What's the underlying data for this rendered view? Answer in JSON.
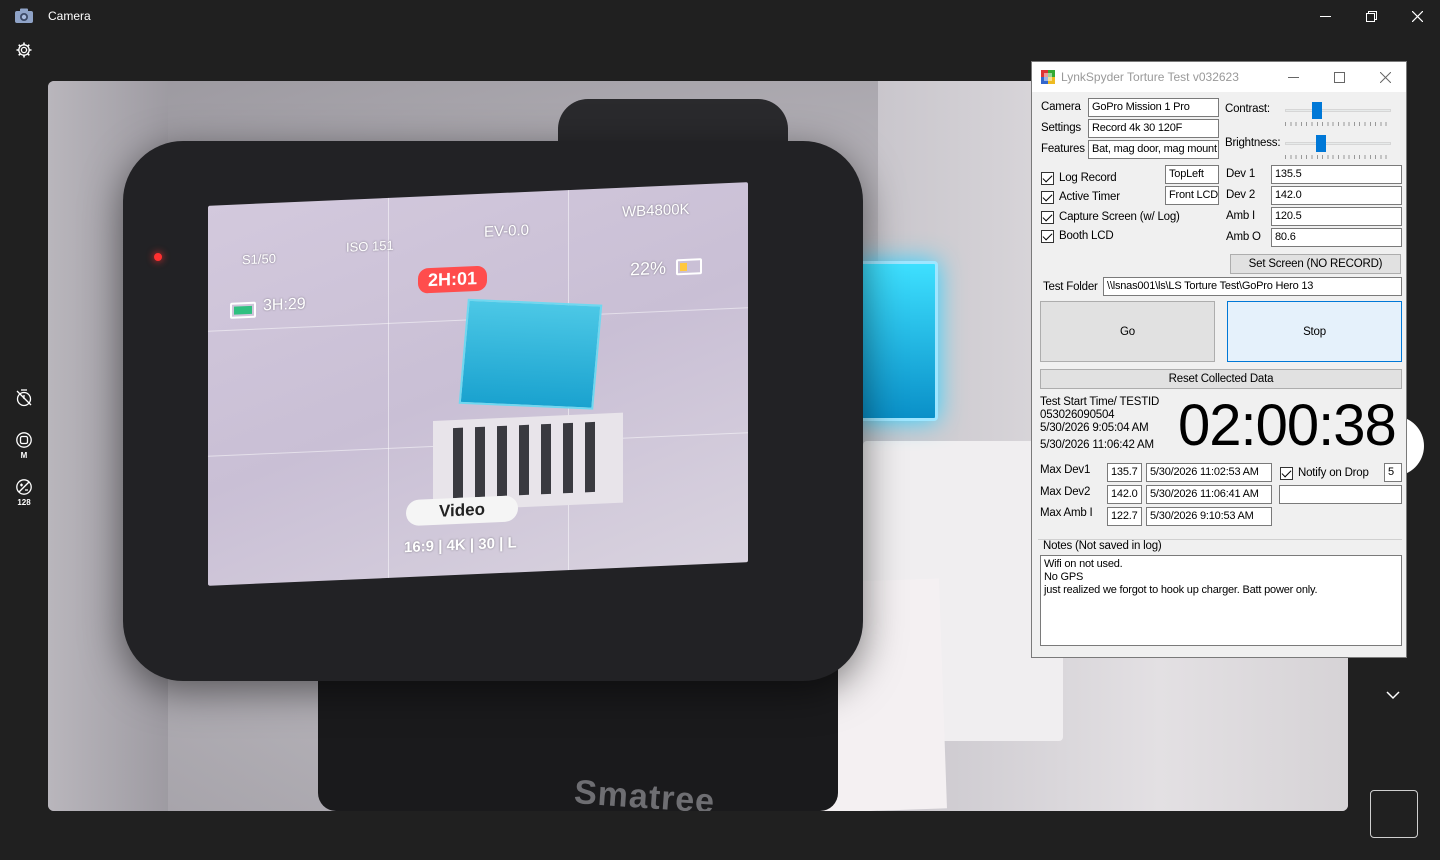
{
  "window": {
    "title": "Camera"
  },
  "sidebar": {
    "video_quality_label": "M",
    "iso_label": "128"
  },
  "camera_lcd": {
    "shutter": "S1/50",
    "iso": "ISO 151",
    "ev": "EV-0.0",
    "wb": "WB4800K",
    "remaining": "3H:29",
    "rec_time": "2H:01",
    "battery": "22%",
    "mode": "Video",
    "format": "16:9 | 4K | 30 | L"
  },
  "scene": {
    "mount_brand": "Smatree"
  },
  "ls": {
    "title": "LynkSpyder Torture Test v032623",
    "camera_label": "Camera",
    "camera_value": "GoPro Mission 1 Pro",
    "settings_label": "Settings",
    "settings_value": "Record 4k 30 120F",
    "features_label": "Features",
    "features_value": "Bat, mag door, mag mount",
    "contrast_label": "Contrast:",
    "contrast_level": 0.28,
    "brightness_label": "Brightness:",
    "brightness_level": 0.32,
    "checks": [
      {
        "label": "Log Record",
        "checked": true
      },
      {
        "label": "Active Timer",
        "checked": true
      },
      {
        "label": "Capture Screen (w/ Log)",
        "checked": true
      },
      {
        "label": "Booth LCD",
        "checked": true
      }
    ],
    "position_value": "TopLeft",
    "lcd_value": "Front LCD",
    "readings": [
      {
        "label": "Dev 1",
        "value": "135.5"
      },
      {
        "label": "Dev 2",
        "value": "142.0"
      },
      {
        "label": "Amb I",
        "value": "120.5"
      },
      {
        "label": "Amb O",
        "value": "80.6"
      }
    ],
    "set_screen_label": "Set Screen (NO RECORD)",
    "test_folder_label": "Test Folder",
    "test_folder_value": "\\\\lsnas001\\ls\\LS Torture Test\\GoPro Hero 13",
    "go_label": "Go",
    "stop_label": "Stop",
    "reset_label": "Reset Collected Data",
    "start_heading": "Test Start Time/ TESTID",
    "test_id": "053026090504",
    "start_time": "5/30/2026 9:05:04 AM",
    "current_time": "5/30/2026 11:06:42 AM",
    "timer": "02:00:38",
    "max": [
      {
        "label": "Max Dev1",
        "value": "135.7",
        "time": "5/30/2026 11:02:53 AM"
      },
      {
        "label": "Max Dev2",
        "value": "142.0",
        "time": "5/30/2026 11:06:41 AM"
      },
      {
        "label": "Max Amb I",
        "value": "122.7",
        "time": "5/30/2026 9:10:53 AM"
      }
    ],
    "notify_label": "Notify on Drop",
    "notify_checked": true,
    "notify_value": "5",
    "notify_extra": "",
    "notes_label": "Notes (Not saved in log)",
    "notes_lines": [
      "Wifi on not used.",
      "No GPS",
      "just realized we forgot to hook up charger.  Batt power only."
    ]
  }
}
